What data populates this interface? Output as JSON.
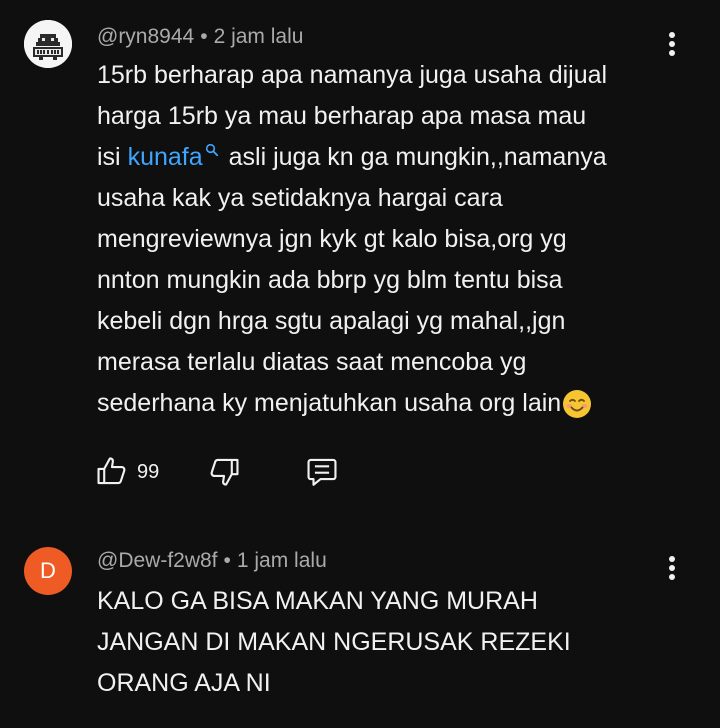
{
  "comments": [
    {
      "username": "@ryn8944",
      "separator": "•",
      "time": "2 jam lalu",
      "avatar_icon": "pixel-robot-avatar",
      "line1": "15rb berharap apa namanya juga usaha dijual",
      "line2": "harga 15rb ya mau berharap apa masa mau",
      "line3_prefix": "isi",
      "line3_link": "kunafa",
      "line3_suffix": "asli juga kn ga mungkin,,namanya",
      "line4": "usaha kak ya setidaknya hargai cara",
      "line5": "mengreviewnya jgn kyk gt kalo bisa,org yg",
      "line6": "nnton mungkin ada bbrp yg blm tentu bisa",
      "line7": "kebeli dgn hrga sgtu apalagi yg mahal,,jgn",
      "line8": "merasa terlalu diatas saat mencoba yg",
      "line9": "sederhana ky menjatuhkan usaha org lain",
      "emoji": "smiling-face-emoji",
      "like_count": "99"
    },
    {
      "username": "@Dew-f2w8f",
      "separator": "•",
      "time": "1 jam lalu",
      "avatar_letter": "D",
      "avatar_color": "#ef5b24",
      "line1": "KALO GA BISA MAKAN YANG MURAH",
      "line2": "JANGAN DI MAKAN NGERUSAK REZEKI",
      "line3": "ORANG AJA NI"
    }
  ],
  "colors": {
    "background": "#0f0f0f",
    "text": "#f1f1f1",
    "meta": "#aaaaaa",
    "link": "#3ea6ff"
  },
  "icons": [
    "like-icon",
    "dislike-icon",
    "reply-icon",
    "more-vert-icon",
    "search-icon"
  ]
}
